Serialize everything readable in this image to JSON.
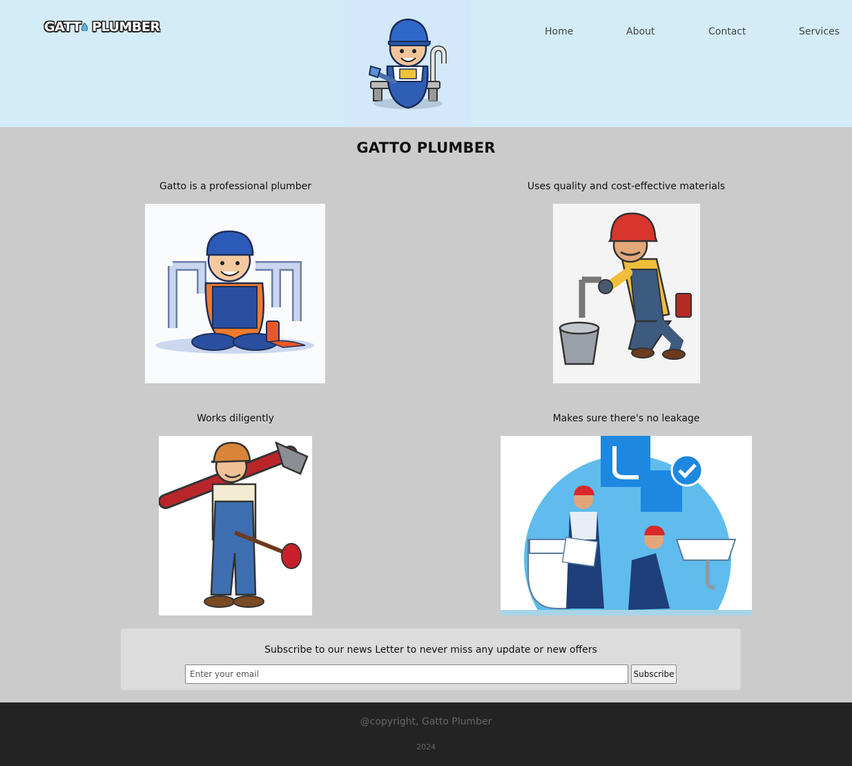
{
  "header": {
    "logo": {
      "word1": "GATT",
      "word2": "PLUMBER",
      "icon": "water-drop-icon"
    },
    "hero_image": "cartoon-plumber-with-wrench",
    "nav": [
      "Home",
      "About",
      "Contact",
      "Services"
    ]
  },
  "main": {
    "title": "GATTO PLUMBER",
    "cards": [
      {
        "caption": "Gatto is a professional plumber",
        "image": "plumber-sitting-with-pipes"
      },
      {
        "caption": "Uses quality and cost-effective materials",
        "image": "plumber-crouching-fixing-faucet"
      },
      {
        "caption": "Works diligently",
        "image": "plumber-with-pipe-wrench-and-plunger"
      },
      {
        "caption": "Makes sure there's no leakage",
        "image": "two-plumbers-bathroom-repair"
      }
    ]
  },
  "newsletter": {
    "text": "Subscribe to our news Letter to never miss any update or new offers",
    "placeholder": "Enter your email",
    "button": "Subscribe"
  },
  "footer": {
    "copyright": "@copyright, Gatto Plumber",
    "year": "2024"
  },
  "colors": {
    "header_bg": "#d4ecf7",
    "body_bg": "#cbcbcb",
    "footer_bg": "#232323",
    "newsletter_bg": "#dcdcdc"
  }
}
